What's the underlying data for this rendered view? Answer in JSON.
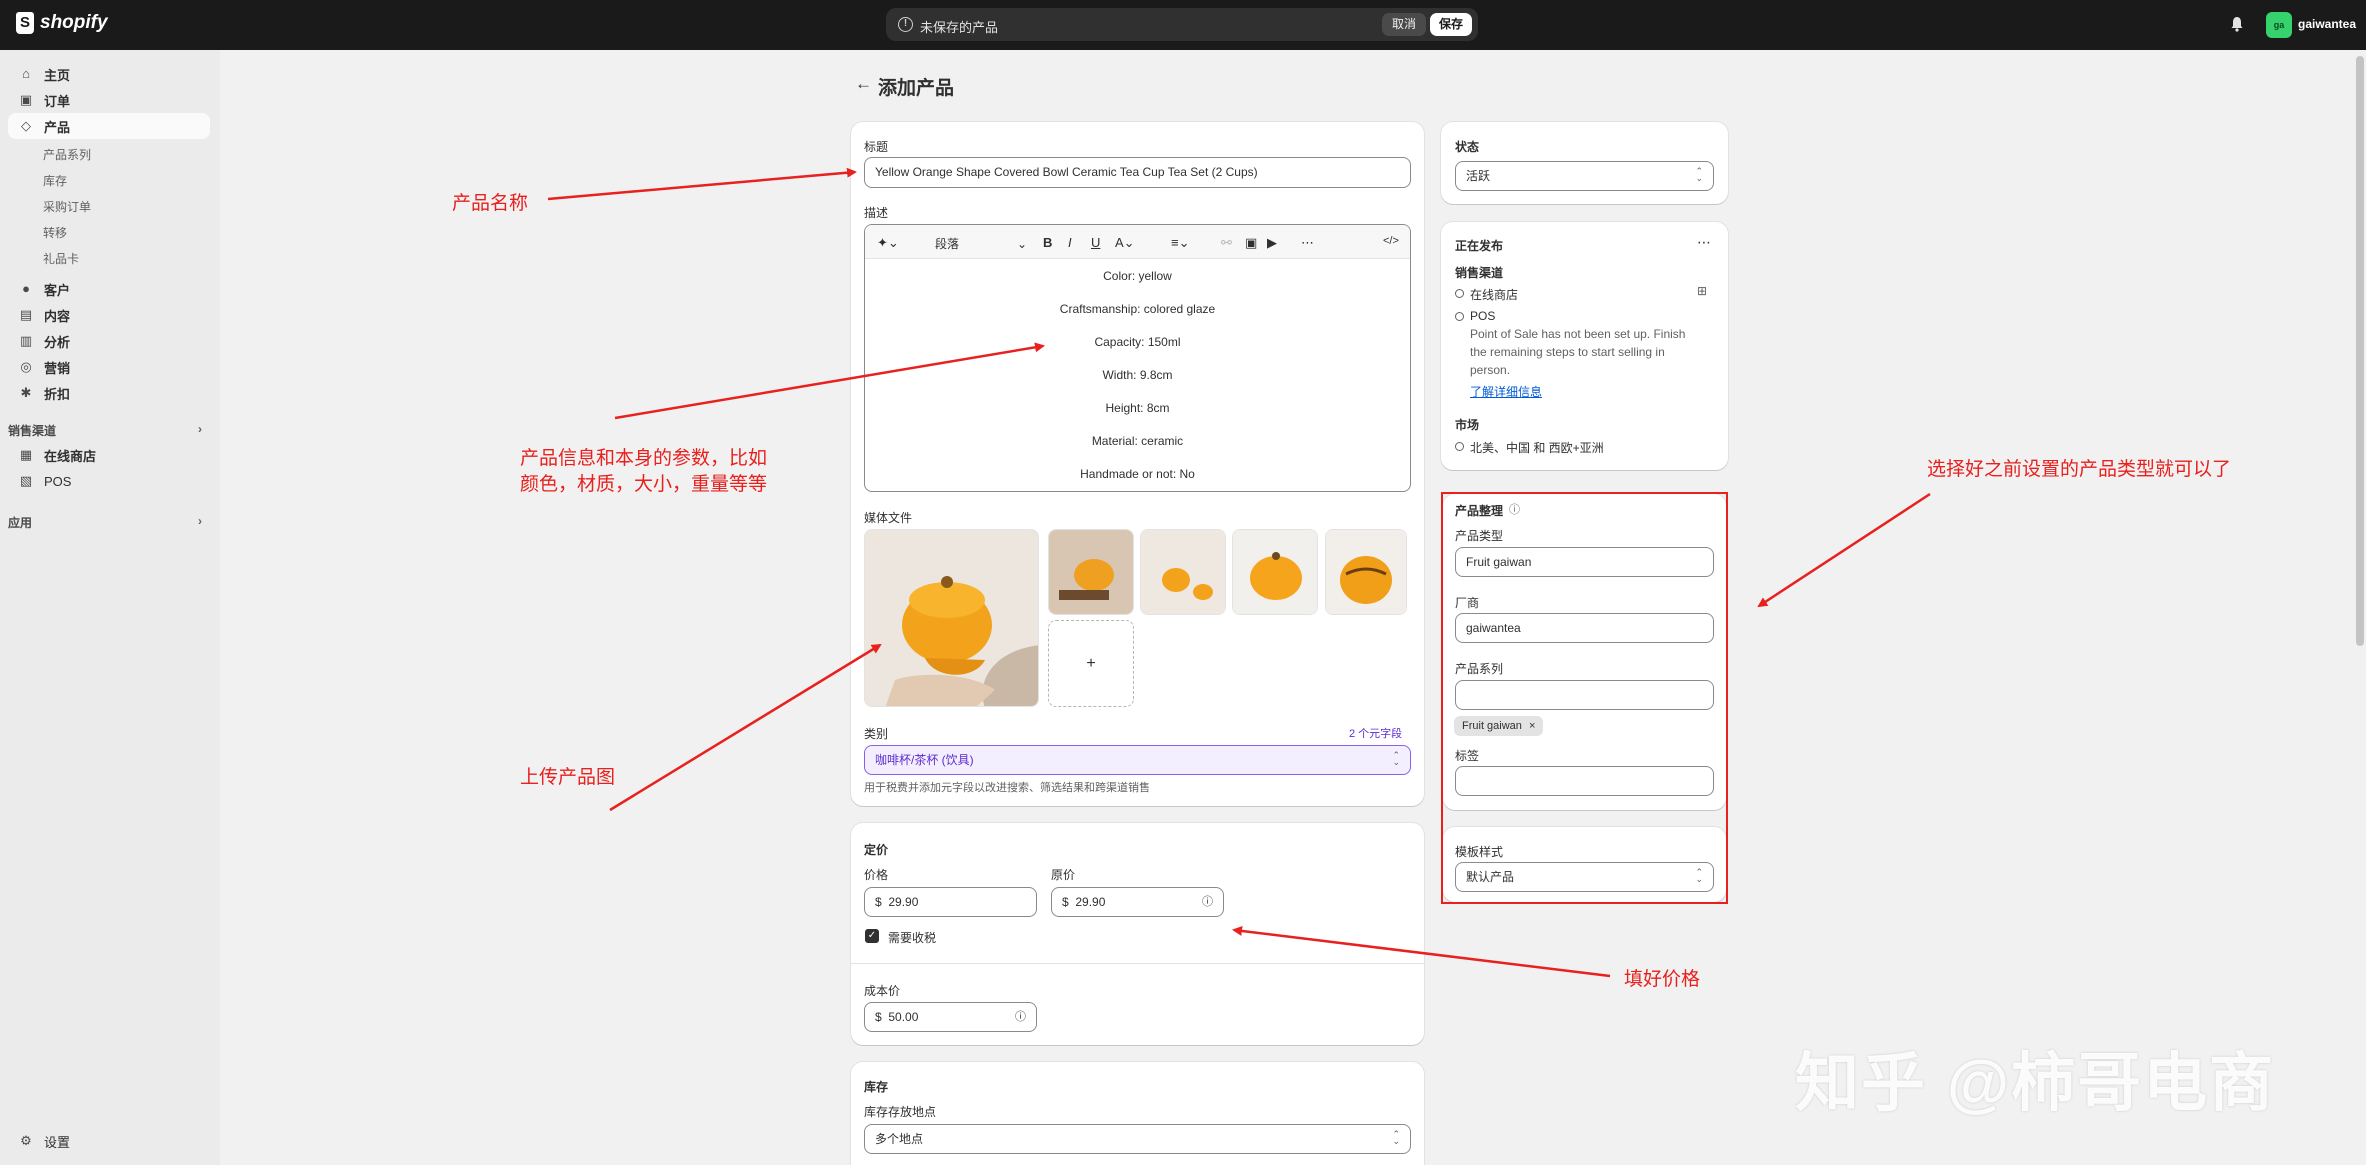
{
  "topbar": {
    "logo_text": "shopify",
    "unsaved_message": "未保存的产品",
    "cancel_label": "取消",
    "save_label": "保存",
    "avatar_initials": "ga",
    "store_name": "gaiwantea"
  },
  "sidebar": {
    "items": [
      {
        "label": "主页",
        "icon": "home-icon"
      },
      {
        "label": "订单",
        "icon": "inbox-icon"
      },
      {
        "label": "产品",
        "icon": "tag-icon"
      },
      {
        "label": "客户",
        "icon": "person-icon"
      },
      {
        "label": "内容",
        "icon": "image-icon"
      },
      {
        "label": "分析",
        "icon": "chart-icon"
      },
      {
        "label": "营销",
        "icon": "target-icon"
      },
      {
        "label": "折扣",
        "icon": "discount-icon"
      }
    ],
    "product_sub": [
      "产品系列",
      "库存",
      "采购订单",
      "转移",
      "礼品卡"
    ],
    "sales_channels_label": "销售渠道",
    "channels": [
      {
        "label": "在线商店",
        "icon": "store-icon"
      },
      {
        "label": "POS",
        "icon": "pos-icon"
      }
    ],
    "apps_label": "应用",
    "settings_label": "设置"
  },
  "page": {
    "title": "添加产品"
  },
  "product": {
    "title_label": "标题",
    "title_value": "Yellow Orange Shape Covered Bowl Ceramic Tea Cup Tea Set (2 Cups)",
    "description_label": "描述",
    "toolbar_paragraph": "段落",
    "description_lines": [
      "Color: yellow",
      "Craftsmanship: colored glaze",
      "Capacity: 150ml",
      "Width: 9.8cm",
      "Height: 8cm",
      "Material: ceramic",
      "Handmade or not: No"
    ],
    "media_label": "媒体文件",
    "add_media": "+",
    "category_label": "类别",
    "category_meta": "2 个元字段",
    "category_value": "咖啡杯/茶杯 (饮具)",
    "category_help": "用于税费并添加元字段以改进搜索、筛选结果和跨渠道销售"
  },
  "pricing": {
    "heading": "定价",
    "price_label": "价格",
    "price_value": "29.90",
    "compare_label": "原价",
    "compare_value": "29.90",
    "currency": "$",
    "tax_label": "需要收税",
    "cost_label": "成本价",
    "cost_value": "50.00"
  },
  "inventory": {
    "heading": "库存",
    "location_label": "库存存放地点",
    "location_value": "多个地点"
  },
  "status": {
    "label": "状态",
    "value": "活跃"
  },
  "publishing": {
    "heading": "正在发布",
    "channels_label": "销售渠道",
    "online_store": "在线商店",
    "pos": "POS",
    "pos_note_lines": [
      "Point of Sale has not been set up. Finish",
      "the remaining steps to start selling in",
      "person."
    ],
    "learn_more": "了解详细信息",
    "markets_label": "市场",
    "markets_value": "北美、中国 和 西欧+亚洲"
  },
  "organization": {
    "heading": "产品整理",
    "type_label": "产品类型",
    "type_value": "Fruit gaiwan",
    "vendor_label": "厂商",
    "vendor_value": "gaiwantea",
    "collections_label": "产品系列",
    "collection_chip": "Fruit gaiwan",
    "tags_label": "标签"
  },
  "template": {
    "label": "模板样式",
    "value": "默认产品"
  },
  "annotations": {
    "product_name": "产品名称",
    "product_info_line1": "产品信息和本身的参数，比如",
    "product_info_line2": "颜色，材质，大小，重量等等",
    "upload_images": "上传产品图",
    "fill_price": "填好价格",
    "choose_type": "选择好之前设置的产品类型就可以了"
  },
  "watermark": "知乎 @柿哥电商",
  "colors": {
    "topbar": "#1a1a1a",
    "annotation_red": "#e8201e",
    "category_purple": "#5c2bd1",
    "link_blue": "#005bd3"
  }
}
